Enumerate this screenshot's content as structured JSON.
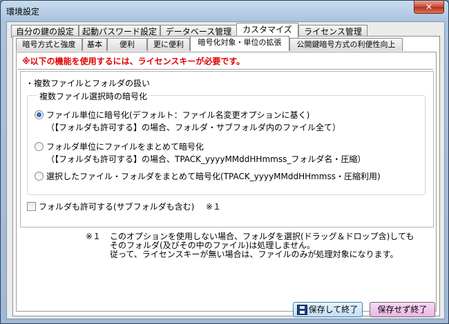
{
  "window": {
    "title": "環境設定",
    "close_glyph": "✕"
  },
  "main_tabs": [
    {
      "label": "自分の鍵の設定"
    },
    {
      "label": "起動パスワード設定"
    },
    {
      "label": "データベース管理"
    },
    {
      "label": "カスタマイズ",
      "active": true
    },
    {
      "label": "ライセンス管理"
    }
  ],
  "sub_tabs": [
    {
      "label": "暗号方式と強度"
    },
    {
      "label": "基本"
    },
    {
      "label": "便利"
    },
    {
      "label": "更に便利"
    },
    {
      "label": "暗号化対象・単位の拡張",
      "active": true
    },
    {
      "label": "公開鍵暗号方式の利便性向上"
    }
  ],
  "warning": "※以下の機能を使用するには、ライセンスキーが必要です。",
  "section_title": "・複数ファイルとフォルダの扱い",
  "group_legend": "複数ファイル選択時の暗号化",
  "options": [
    {
      "line1": "ファイル単位に暗号化(デフォルト：ファイル名変更オプションに基く)",
      "line2": "（【フォルダも許可する】の場合、フォルダ・サブフォルダ内のファイル全て）",
      "checked": true
    },
    {
      "line1": "フォルダ単位にファイルをまとめて暗号化",
      "line2": "（【フォルダも許可する】の場合、TPACK_yyyyMMddHHmmss_フォルダ名・圧縮）",
      "checked": false
    },
    {
      "line1": "選択したファイル・フォルダをまとめて暗号化(TPACK_yyyyMMddHHmmss・圧縮利用)",
      "line2": "",
      "checked": false
    }
  ],
  "checkbox": {
    "label": "フォルダも許可する(サブフォルダも含む)",
    "mark": "※１",
    "checked": false
  },
  "note": {
    "mark": "※１",
    "line1": "このオプションを使用しない場合、フォルダを選択(ドラッグ＆ドロップ含)しても",
    "line2": "そのフォルダ(及びその中のファイル)は処理しません。",
    "line3": "従って、ライセンスキーが無い場合は、ファイルのみが処理対象になります。"
  },
  "buttons": {
    "save": "保存して終了",
    "no_save": "保存せず終了"
  }
}
